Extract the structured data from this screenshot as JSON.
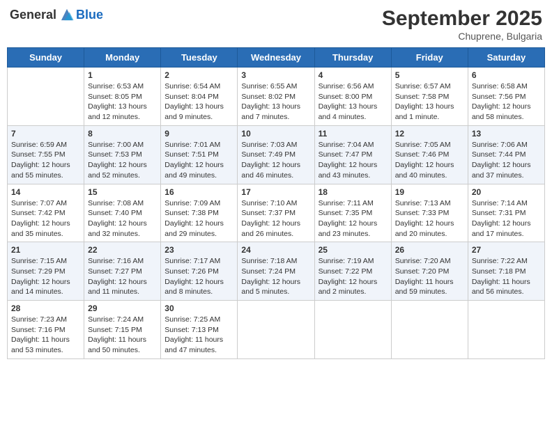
{
  "header": {
    "logo_general": "General",
    "logo_blue": "Blue",
    "month": "September 2025",
    "location": "Chuprene, Bulgaria"
  },
  "weekdays": [
    "Sunday",
    "Monday",
    "Tuesday",
    "Wednesday",
    "Thursday",
    "Friday",
    "Saturday"
  ],
  "weeks": [
    [
      {
        "day": "",
        "info": ""
      },
      {
        "day": "1",
        "info": "Sunrise: 6:53 AM\nSunset: 8:05 PM\nDaylight: 13 hours\nand 12 minutes."
      },
      {
        "day": "2",
        "info": "Sunrise: 6:54 AM\nSunset: 8:04 PM\nDaylight: 13 hours\nand 9 minutes."
      },
      {
        "day": "3",
        "info": "Sunrise: 6:55 AM\nSunset: 8:02 PM\nDaylight: 13 hours\nand 7 minutes."
      },
      {
        "day": "4",
        "info": "Sunrise: 6:56 AM\nSunset: 8:00 PM\nDaylight: 13 hours\nand 4 minutes."
      },
      {
        "day": "5",
        "info": "Sunrise: 6:57 AM\nSunset: 7:58 PM\nDaylight: 13 hours\nand 1 minute."
      },
      {
        "day": "6",
        "info": "Sunrise: 6:58 AM\nSunset: 7:56 PM\nDaylight: 12 hours\nand 58 minutes."
      }
    ],
    [
      {
        "day": "7",
        "info": "Sunrise: 6:59 AM\nSunset: 7:55 PM\nDaylight: 12 hours\nand 55 minutes."
      },
      {
        "day": "8",
        "info": "Sunrise: 7:00 AM\nSunset: 7:53 PM\nDaylight: 12 hours\nand 52 minutes."
      },
      {
        "day": "9",
        "info": "Sunrise: 7:01 AM\nSunset: 7:51 PM\nDaylight: 12 hours\nand 49 minutes."
      },
      {
        "day": "10",
        "info": "Sunrise: 7:03 AM\nSunset: 7:49 PM\nDaylight: 12 hours\nand 46 minutes."
      },
      {
        "day": "11",
        "info": "Sunrise: 7:04 AM\nSunset: 7:47 PM\nDaylight: 12 hours\nand 43 minutes."
      },
      {
        "day": "12",
        "info": "Sunrise: 7:05 AM\nSunset: 7:46 PM\nDaylight: 12 hours\nand 40 minutes."
      },
      {
        "day": "13",
        "info": "Sunrise: 7:06 AM\nSunset: 7:44 PM\nDaylight: 12 hours\nand 37 minutes."
      }
    ],
    [
      {
        "day": "14",
        "info": "Sunrise: 7:07 AM\nSunset: 7:42 PM\nDaylight: 12 hours\nand 35 minutes."
      },
      {
        "day": "15",
        "info": "Sunrise: 7:08 AM\nSunset: 7:40 PM\nDaylight: 12 hours\nand 32 minutes."
      },
      {
        "day": "16",
        "info": "Sunrise: 7:09 AM\nSunset: 7:38 PM\nDaylight: 12 hours\nand 29 minutes."
      },
      {
        "day": "17",
        "info": "Sunrise: 7:10 AM\nSunset: 7:37 PM\nDaylight: 12 hours\nand 26 minutes."
      },
      {
        "day": "18",
        "info": "Sunrise: 7:11 AM\nSunset: 7:35 PM\nDaylight: 12 hours\nand 23 minutes."
      },
      {
        "day": "19",
        "info": "Sunrise: 7:13 AM\nSunset: 7:33 PM\nDaylight: 12 hours\nand 20 minutes."
      },
      {
        "day": "20",
        "info": "Sunrise: 7:14 AM\nSunset: 7:31 PM\nDaylight: 12 hours\nand 17 minutes."
      }
    ],
    [
      {
        "day": "21",
        "info": "Sunrise: 7:15 AM\nSunset: 7:29 PM\nDaylight: 12 hours\nand 14 minutes."
      },
      {
        "day": "22",
        "info": "Sunrise: 7:16 AM\nSunset: 7:27 PM\nDaylight: 12 hours\nand 11 minutes."
      },
      {
        "day": "23",
        "info": "Sunrise: 7:17 AM\nSunset: 7:26 PM\nDaylight: 12 hours\nand 8 minutes."
      },
      {
        "day": "24",
        "info": "Sunrise: 7:18 AM\nSunset: 7:24 PM\nDaylight: 12 hours\nand 5 minutes."
      },
      {
        "day": "25",
        "info": "Sunrise: 7:19 AM\nSunset: 7:22 PM\nDaylight: 12 hours\nand 2 minutes."
      },
      {
        "day": "26",
        "info": "Sunrise: 7:20 AM\nSunset: 7:20 PM\nDaylight: 11 hours\nand 59 minutes."
      },
      {
        "day": "27",
        "info": "Sunrise: 7:22 AM\nSunset: 7:18 PM\nDaylight: 11 hours\nand 56 minutes."
      }
    ],
    [
      {
        "day": "28",
        "info": "Sunrise: 7:23 AM\nSunset: 7:16 PM\nDaylight: 11 hours\nand 53 minutes."
      },
      {
        "day": "29",
        "info": "Sunrise: 7:24 AM\nSunset: 7:15 PM\nDaylight: 11 hours\nand 50 minutes."
      },
      {
        "day": "30",
        "info": "Sunrise: 7:25 AM\nSunset: 7:13 PM\nDaylight: 11 hours\nand 47 minutes."
      },
      {
        "day": "",
        "info": ""
      },
      {
        "day": "",
        "info": ""
      },
      {
        "day": "",
        "info": ""
      },
      {
        "day": "",
        "info": ""
      }
    ]
  ]
}
